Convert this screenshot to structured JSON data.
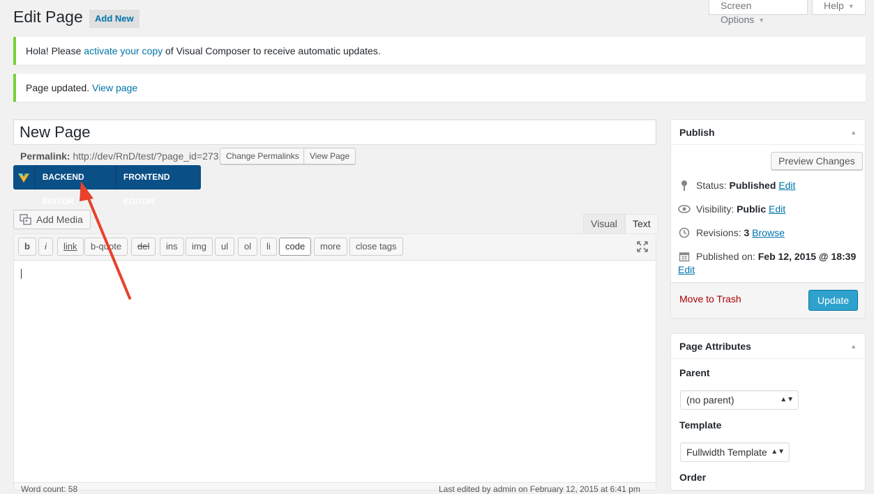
{
  "header": {
    "title": "Edit Page",
    "add_new": "Add New",
    "screen_options": "Screen Options",
    "help": "Help"
  },
  "notices": {
    "vc_before": "Hola! Please",
    "vc_link": "activate your copy",
    "vc_after": "of Visual Composer to receive automatic updates.",
    "updated_text": "Page updated.",
    "updated_link": "View page"
  },
  "post": {
    "title": "New Page",
    "permalink_label": "Permalink:",
    "permalink_url": "http://dev/RnD/test/?page_id=2731",
    "change_permalinks": "Change Permalinks",
    "view_page": "View Page"
  },
  "vc": {
    "backend": "BACKEND EDITOR",
    "frontend": "FRONTEND EDITOR"
  },
  "editor": {
    "add_media": "Add Media",
    "tab_visual": "Visual",
    "tab_text": "Text",
    "quicktags": [
      "b",
      "i",
      "link",
      "b-quote",
      "del",
      "ins",
      "img",
      "ul",
      "ol",
      "li",
      "code",
      "more",
      "close tags"
    ],
    "word_count": "Word count: 58",
    "last_edited": "Last edited by admin on February 12, 2015 at 6:41 pm"
  },
  "publish": {
    "title": "Publish",
    "preview": "Preview Changes",
    "status_label": "Status:",
    "status_value": "Published",
    "visibility_label": "Visibility:",
    "visibility_value": "Public",
    "revisions_label": "Revisions:",
    "revisions_value": "3",
    "browse": "Browse",
    "published_label": "Published on:",
    "published_value": "Feb 12, 2015 @ 18:39",
    "edit": "Edit",
    "trash": "Move to Trash",
    "update": "Update"
  },
  "attributes": {
    "title": "Page Attributes",
    "parent_label": "Parent",
    "parent_value": "(no parent)",
    "template_label": "Template",
    "template_value": "Fullwidth Template",
    "order_label": "Order"
  },
  "colors": {
    "vc_bar": "#0a4f86",
    "notice_border": "#7ad03a",
    "link": "#0073aa",
    "update_button": "#2ea2cc",
    "arrow": "#e8412c"
  }
}
